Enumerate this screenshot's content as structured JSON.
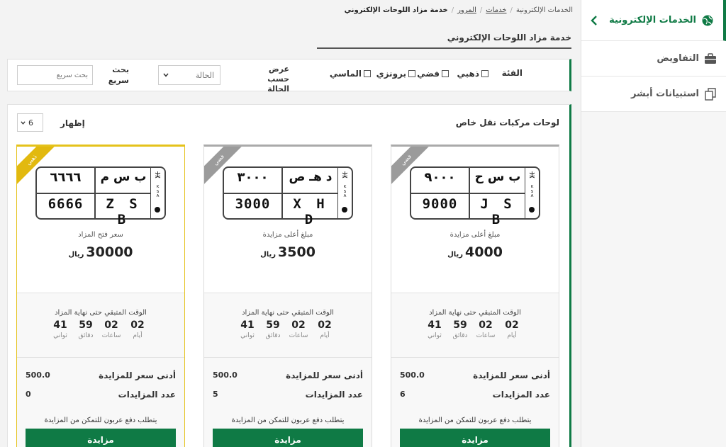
{
  "sidebar": {
    "items": [
      {
        "label": "الخدمات الإلكترونية",
        "icon": "globe-icon"
      },
      {
        "label": "التفاويض",
        "icon": "briefcase-icon"
      },
      {
        "label": "استبيانات أبشر",
        "icon": "copy-documents-icon"
      }
    ]
  },
  "breadcrumb": {
    "home": "الخدمات الإلكترونية",
    "services": "خدمات",
    "traffic": "المرور",
    "current": "خدمة مزاد اللوحات الإلكتروني"
  },
  "page_title": "خدمة مزاد اللوحات الإلكتروني",
  "filter": {
    "category_label": "الفئة",
    "options": [
      "ذهبي",
      "فضي",
      "برونزي",
      "الماسي"
    ],
    "status_label": "عرض حسب الحالة",
    "status_value": "الحالة",
    "search_label": "بحث سريع",
    "search_placeholder": "بحث سريع"
  },
  "listing": {
    "title": "لوحات مركبات نقل خاص",
    "show_label": "إظهار",
    "show_value": "6"
  },
  "cards": [
    {
      "tier": "فضي",
      "color": "#9b9b9b",
      "plate": {
        "letters_ar": "ب س ح",
        "numbers_ar": "٩٠٠٠",
        "letters_en": "J S B",
        "numbers_en": "9000"
      },
      "price_label": "مبلغ أعلى مزايدة",
      "price": "4000",
      "currency": "ريال",
      "timer_label": "الوقت المتبقي حتى نهاية المزاد",
      "timer": [
        {
          "value": "02",
          "unit": "أيام"
        },
        {
          "value": "02",
          "unit": "ساعات"
        },
        {
          "value": "59",
          "unit": "دقائق"
        },
        {
          "value": "41",
          "unit": "ثواني"
        }
      ],
      "min_bid_label": "أدنى سعر للمزايدة",
      "min_bid": "500.0",
      "bids_count_label": "عدد المزايدات",
      "bids_count": "6",
      "note": "يتطلب دفع عربون للتمكن من المزايدة",
      "button": "مزايدة"
    },
    {
      "tier": "فضي",
      "color": "#9b9b9b",
      "plate": {
        "letters_ar": "د هـ ص",
        "numbers_ar": "٣٠٠٠",
        "letters_en": "X H D",
        "numbers_en": "3000"
      },
      "price_label": "مبلغ أعلى مزايدة",
      "price": "3500",
      "currency": "ريال",
      "timer_label": "الوقت المتبقي حتى نهاية المزاد",
      "timer": [
        {
          "value": "02",
          "unit": "أيام"
        },
        {
          "value": "02",
          "unit": "ساعات"
        },
        {
          "value": "59",
          "unit": "دقائق"
        },
        {
          "value": "41",
          "unit": "ثواني"
        }
      ],
      "min_bid_label": "أدنى سعر للمزايدة",
      "min_bid": "500.0",
      "bids_count_label": "عدد المزايدات",
      "bids_count": "5",
      "note": "يتطلب دفع عربون للتمكن من المزايدة",
      "button": "مزايدة"
    },
    {
      "tier": "ذهبي",
      "color": "#e2b90f",
      "plate": {
        "letters_ar": "ب س م",
        "numbers_ar": "٦٦٦٦",
        "letters_en": "Z S B",
        "numbers_en": "6666"
      },
      "price_label": "سعر فتح المزاد",
      "price": "30000",
      "currency": "ريال",
      "timer_label": "الوقت المتبقي حتى نهاية المزاد",
      "timer": [
        {
          "value": "02",
          "unit": "أيام"
        },
        {
          "value": "02",
          "unit": "ساعات"
        },
        {
          "value": "59",
          "unit": "دقائق"
        },
        {
          "value": "41",
          "unit": "ثواني"
        }
      ],
      "min_bid_label": "أدنى سعر للمزايدة",
      "min_bid": "500.0",
      "bids_count_label": "عدد المزايدات",
      "bids_count": "0",
      "note": "يتطلب دفع عربون للتمكن من المزايدة",
      "button": "مزايدة"
    }
  ],
  "plate_ksa": {
    "letters": [
      "K",
      "S",
      "A"
    ]
  }
}
